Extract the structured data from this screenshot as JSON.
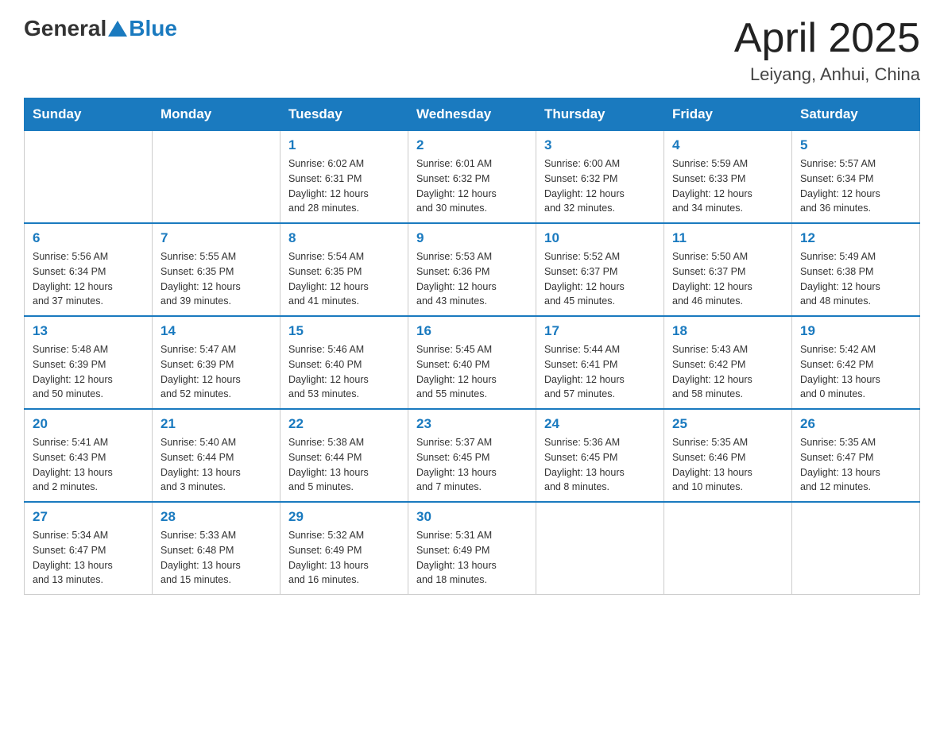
{
  "header": {
    "logo_general": "General",
    "logo_blue": "Blue",
    "title": "April 2025",
    "location": "Leiyang, Anhui, China"
  },
  "weekdays": [
    "Sunday",
    "Monday",
    "Tuesday",
    "Wednesday",
    "Thursday",
    "Friday",
    "Saturday"
  ],
  "weeks": [
    [
      {
        "day": "",
        "info": ""
      },
      {
        "day": "",
        "info": ""
      },
      {
        "day": "1",
        "info": "Sunrise: 6:02 AM\nSunset: 6:31 PM\nDaylight: 12 hours\nand 28 minutes."
      },
      {
        "day": "2",
        "info": "Sunrise: 6:01 AM\nSunset: 6:32 PM\nDaylight: 12 hours\nand 30 minutes."
      },
      {
        "day": "3",
        "info": "Sunrise: 6:00 AM\nSunset: 6:32 PM\nDaylight: 12 hours\nand 32 minutes."
      },
      {
        "day": "4",
        "info": "Sunrise: 5:59 AM\nSunset: 6:33 PM\nDaylight: 12 hours\nand 34 minutes."
      },
      {
        "day": "5",
        "info": "Sunrise: 5:57 AM\nSunset: 6:34 PM\nDaylight: 12 hours\nand 36 minutes."
      }
    ],
    [
      {
        "day": "6",
        "info": "Sunrise: 5:56 AM\nSunset: 6:34 PM\nDaylight: 12 hours\nand 37 minutes."
      },
      {
        "day": "7",
        "info": "Sunrise: 5:55 AM\nSunset: 6:35 PM\nDaylight: 12 hours\nand 39 minutes."
      },
      {
        "day": "8",
        "info": "Sunrise: 5:54 AM\nSunset: 6:35 PM\nDaylight: 12 hours\nand 41 minutes."
      },
      {
        "day": "9",
        "info": "Sunrise: 5:53 AM\nSunset: 6:36 PM\nDaylight: 12 hours\nand 43 minutes."
      },
      {
        "day": "10",
        "info": "Sunrise: 5:52 AM\nSunset: 6:37 PM\nDaylight: 12 hours\nand 45 minutes."
      },
      {
        "day": "11",
        "info": "Sunrise: 5:50 AM\nSunset: 6:37 PM\nDaylight: 12 hours\nand 46 minutes."
      },
      {
        "day": "12",
        "info": "Sunrise: 5:49 AM\nSunset: 6:38 PM\nDaylight: 12 hours\nand 48 minutes."
      }
    ],
    [
      {
        "day": "13",
        "info": "Sunrise: 5:48 AM\nSunset: 6:39 PM\nDaylight: 12 hours\nand 50 minutes."
      },
      {
        "day": "14",
        "info": "Sunrise: 5:47 AM\nSunset: 6:39 PM\nDaylight: 12 hours\nand 52 minutes."
      },
      {
        "day": "15",
        "info": "Sunrise: 5:46 AM\nSunset: 6:40 PM\nDaylight: 12 hours\nand 53 minutes."
      },
      {
        "day": "16",
        "info": "Sunrise: 5:45 AM\nSunset: 6:40 PM\nDaylight: 12 hours\nand 55 minutes."
      },
      {
        "day": "17",
        "info": "Sunrise: 5:44 AM\nSunset: 6:41 PM\nDaylight: 12 hours\nand 57 minutes."
      },
      {
        "day": "18",
        "info": "Sunrise: 5:43 AM\nSunset: 6:42 PM\nDaylight: 12 hours\nand 58 minutes."
      },
      {
        "day": "19",
        "info": "Sunrise: 5:42 AM\nSunset: 6:42 PM\nDaylight: 13 hours\nand 0 minutes."
      }
    ],
    [
      {
        "day": "20",
        "info": "Sunrise: 5:41 AM\nSunset: 6:43 PM\nDaylight: 13 hours\nand 2 minutes."
      },
      {
        "day": "21",
        "info": "Sunrise: 5:40 AM\nSunset: 6:44 PM\nDaylight: 13 hours\nand 3 minutes."
      },
      {
        "day": "22",
        "info": "Sunrise: 5:38 AM\nSunset: 6:44 PM\nDaylight: 13 hours\nand 5 minutes."
      },
      {
        "day": "23",
        "info": "Sunrise: 5:37 AM\nSunset: 6:45 PM\nDaylight: 13 hours\nand 7 minutes."
      },
      {
        "day": "24",
        "info": "Sunrise: 5:36 AM\nSunset: 6:45 PM\nDaylight: 13 hours\nand 8 minutes."
      },
      {
        "day": "25",
        "info": "Sunrise: 5:35 AM\nSunset: 6:46 PM\nDaylight: 13 hours\nand 10 minutes."
      },
      {
        "day": "26",
        "info": "Sunrise: 5:35 AM\nSunset: 6:47 PM\nDaylight: 13 hours\nand 12 minutes."
      }
    ],
    [
      {
        "day": "27",
        "info": "Sunrise: 5:34 AM\nSunset: 6:47 PM\nDaylight: 13 hours\nand 13 minutes."
      },
      {
        "day": "28",
        "info": "Sunrise: 5:33 AM\nSunset: 6:48 PM\nDaylight: 13 hours\nand 15 minutes."
      },
      {
        "day": "29",
        "info": "Sunrise: 5:32 AM\nSunset: 6:49 PM\nDaylight: 13 hours\nand 16 minutes."
      },
      {
        "day": "30",
        "info": "Sunrise: 5:31 AM\nSunset: 6:49 PM\nDaylight: 13 hours\nand 18 minutes."
      },
      {
        "day": "",
        "info": ""
      },
      {
        "day": "",
        "info": ""
      },
      {
        "day": "",
        "info": ""
      }
    ]
  ]
}
